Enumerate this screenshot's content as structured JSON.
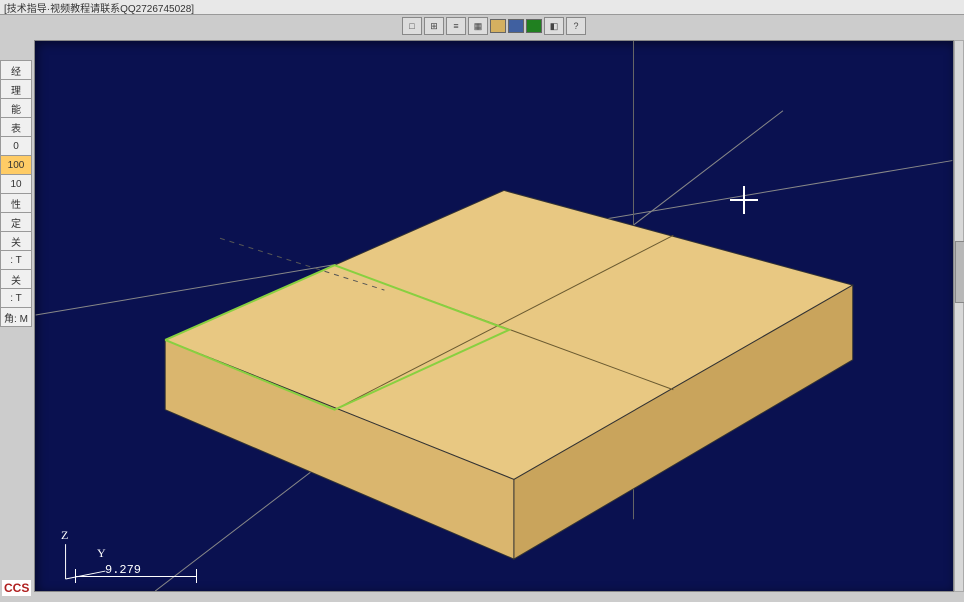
{
  "title_bar": "[技术指导·视频教程请联系QQ2726745028]",
  "toolbar": {
    "btn_a": "□",
    "btn_b": "⊞",
    "btn_c": "≡",
    "btn_d": "▦",
    "color_a": "#d4b060",
    "color_b": "#4060a0",
    "color_c": "#208020",
    "btn_e": "◧",
    "btn_f": "?"
  },
  "left_panel": {
    "items": [
      {
        "label": "经",
        "selected": false
      },
      {
        "label": "理",
        "selected": false
      },
      {
        "label": "能",
        "selected": false
      },
      {
        "label": "表",
        "selected": false
      },
      {
        "label": "0",
        "selected": false
      },
      {
        "label": "100",
        "selected": true
      },
      {
        "label": "10",
        "selected": false
      },
      {
        "label": "性",
        "selected": false
      },
      {
        "label": "定",
        "selected": false
      },
      {
        "label": "关",
        "selected": false
      },
      {
        "label": ": T",
        "selected": false
      },
      {
        "label": "关",
        "selected": false
      },
      {
        "label": ": T",
        "selected": false
      },
      {
        "label": "角: M",
        "selected": false
      }
    ]
  },
  "viewport": {
    "axis_z": "Z",
    "axis_y": "Y",
    "scale_value": "9.279",
    "solid": {
      "top_fill": "#e8c882",
      "front_fill": "#dab66e",
      "side_fill": "#c9a45c",
      "edge": "#333"
    }
  },
  "brand": "CCS"
}
